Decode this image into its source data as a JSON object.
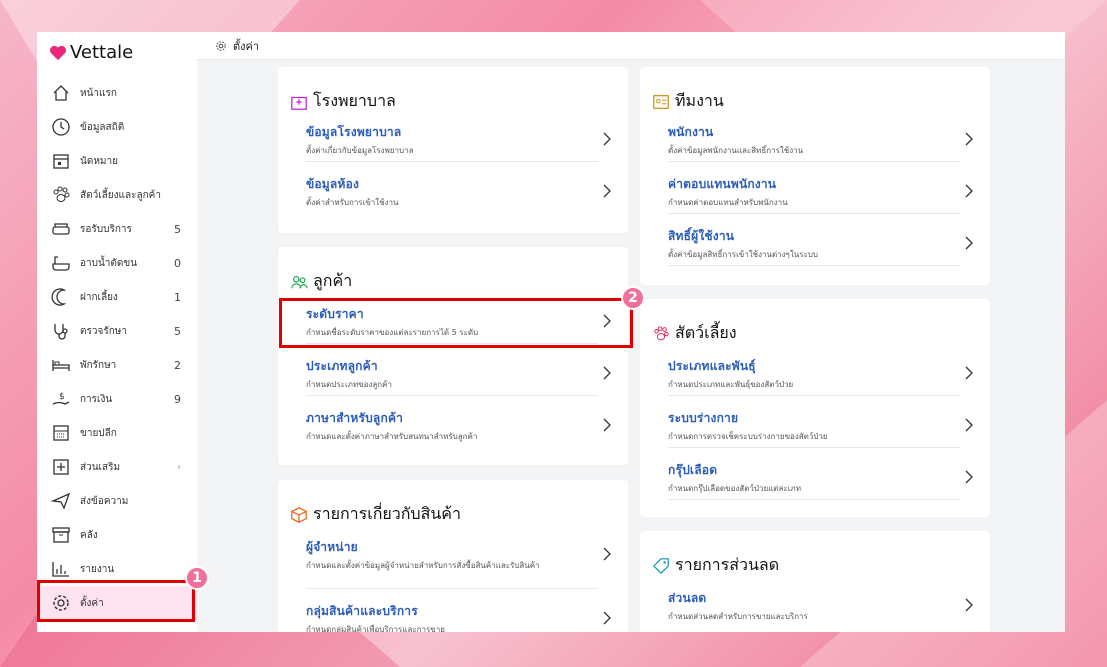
{
  "app": {
    "brand": "Vettale",
    "breadcrumb": "ตั้งค่า"
  },
  "sidebar": {
    "items": [
      {
        "label": "หน้าแรก",
        "icon": "home-icon"
      },
      {
        "label": "ข้อมูลสถิติ",
        "icon": "stats-icon"
      },
      {
        "label": "นัดหมาย",
        "icon": "calendar-icon"
      },
      {
        "label": "สัตว์เลี้ยงและลูกค้า",
        "icon": "paw-icon"
      },
      {
        "label": "รอรับบริการ",
        "icon": "sofa-icon",
        "count": "5"
      },
      {
        "label": "อาบน้ำตัดขน",
        "icon": "bathtub-icon",
        "count": "0"
      },
      {
        "label": "ฝากเลี้ยง",
        "icon": "moon-icon",
        "count": "1"
      },
      {
        "label": "ตรวจรักษา",
        "icon": "stethoscope-icon",
        "count": "5"
      },
      {
        "label": "พักรักษา",
        "icon": "bed-icon",
        "count": "2"
      },
      {
        "label": "การเงิน",
        "icon": "money-icon",
        "count": "9"
      },
      {
        "label": "ขายปลีก",
        "icon": "register-icon"
      },
      {
        "label": "ส่วนเสริม",
        "icon": "plus-icon",
        "chevron": "›"
      },
      {
        "label": "ส่งข้อความ",
        "icon": "send-icon"
      },
      {
        "label": "คลัง",
        "icon": "archive-icon"
      },
      {
        "label": "รายงาน",
        "icon": "report-icon"
      },
      {
        "label": "ตั้งค่า",
        "icon": "gear-icon",
        "active": true
      }
    ]
  },
  "badges": {
    "one": "1",
    "two": "2"
  },
  "cards": {
    "hospital": {
      "title": "โรงพยาบาล",
      "rows": [
        {
          "title": "ข้อมูลโรงพยาบาล",
          "desc": "ตั้งค่าเกี่ยวกับข้อมูลโรงพยาบาล"
        },
        {
          "title": "ข้อมูลห้อง",
          "desc": "ตั้งค่าสำหรับการเข้าใช้งาน"
        }
      ]
    },
    "customer": {
      "title": "ลูกค้า",
      "rows": [
        {
          "title": "ระดับราคา",
          "desc": "กำหนดชื่อระดับราคาของแต่ละรายการได้ 5 ระดับ"
        },
        {
          "title": "ประเภทลูกค้า",
          "desc": "กำหนดประเภทของลูกค้า"
        },
        {
          "title": "ภาษาสำหรับลูกค้า",
          "desc": "กำหนดและตั้งค่าภาษาสำหรับสนทนาสำหรับลูกค้า"
        }
      ]
    },
    "products": {
      "title": "รายการเกี่ยวกับสินค้า",
      "rows": [
        {
          "title": "ผู้จำหน่าย",
          "desc": "กำหนดและตั้งค่าข้อมูลผู้จำหน่ายสำหรับการสั่งซื้อสินค้าและรับสินค้า"
        },
        {
          "title": "กลุ่มสินค้าและบริการ",
          "desc": "กำหนดกลุ่มสินค้าเพื่อบริการและการขาย"
        }
      ]
    },
    "staff": {
      "title": "ทีมงาน",
      "rows": [
        {
          "title": "พนักงาน",
          "desc": "ตั้งค่าข้อมูลพนักงานและสิทธิ์การใช้งาน"
        },
        {
          "title": "ค่าตอบแทนพนักงาน",
          "desc": "กำหนดค่าตอบแทนสำหรับพนักงาน"
        },
        {
          "title": "สิทธิ์ผู้ใช้งาน",
          "desc": "ตั้งค่าข้อมูลสิทธิ์การเข้าใช้งานต่างๆในระบบ"
        }
      ]
    },
    "pets": {
      "title": "สัตว์เลี้ยง",
      "rows": [
        {
          "title": "ประเภทและพันธุ์",
          "desc": "กำหนดประเภทและพันธุ์ของสัตว์ป่วย"
        },
        {
          "title": "ระบบร่างกาย",
          "desc": "กำหนดการตรวจเช็คระบบร่างกายของสัตว์ป่วย"
        },
        {
          "title": "กรุ๊ปเลือด",
          "desc": "กำหนดกรุ๊ปเลือดของสัตว์ป่วยแต่ละเภท"
        }
      ]
    },
    "discount": {
      "title": "รายการส่วนลด",
      "rows": [
        {
          "title": "ส่วนลด",
          "desc": "กำหนดส่วนลดสำหรับการขายและบริการ"
        }
      ]
    }
  },
  "colors": {
    "accent": "#2b5db8",
    "highlight": "#e00000",
    "badge": "#f26f9a",
    "active_bg": "#fde3ef"
  }
}
